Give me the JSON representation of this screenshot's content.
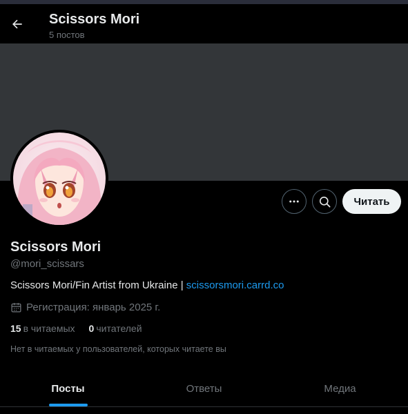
{
  "header": {
    "title": "Scissors Mori",
    "subtitle": "5 постов",
    "back_icon": "arrow-left-icon"
  },
  "profile": {
    "name": "Scissors Mori",
    "handle": "@mori_scissars",
    "bio_text": "Scissors Mori/Fin Artist from Ukraine | ",
    "bio_link": "scissorsmori.carrd.co",
    "joined": "Регистрация: январь 2025 г.",
    "following_count": "15",
    "following_label": "в читаемых",
    "followers_count": "0",
    "followers_label": "читателей",
    "followers_note": "Нет в читаемых у пользователей, которых читаете вы"
  },
  "actions": {
    "more_icon": "more-horizontal-icon",
    "search_icon": "search-icon",
    "follow_label": "Читать"
  },
  "tabs": [
    {
      "label": "Посты",
      "active": true
    },
    {
      "label": "Ответы",
      "active": false
    },
    {
      "label": "Медиа",
      "active": false
    }
  ],
  "colors": {
    "accent": "#1d9bf0",
    "banner": "#333639",
    "background": "#000000",
    "muted_text": "#71767b"
  }
}
